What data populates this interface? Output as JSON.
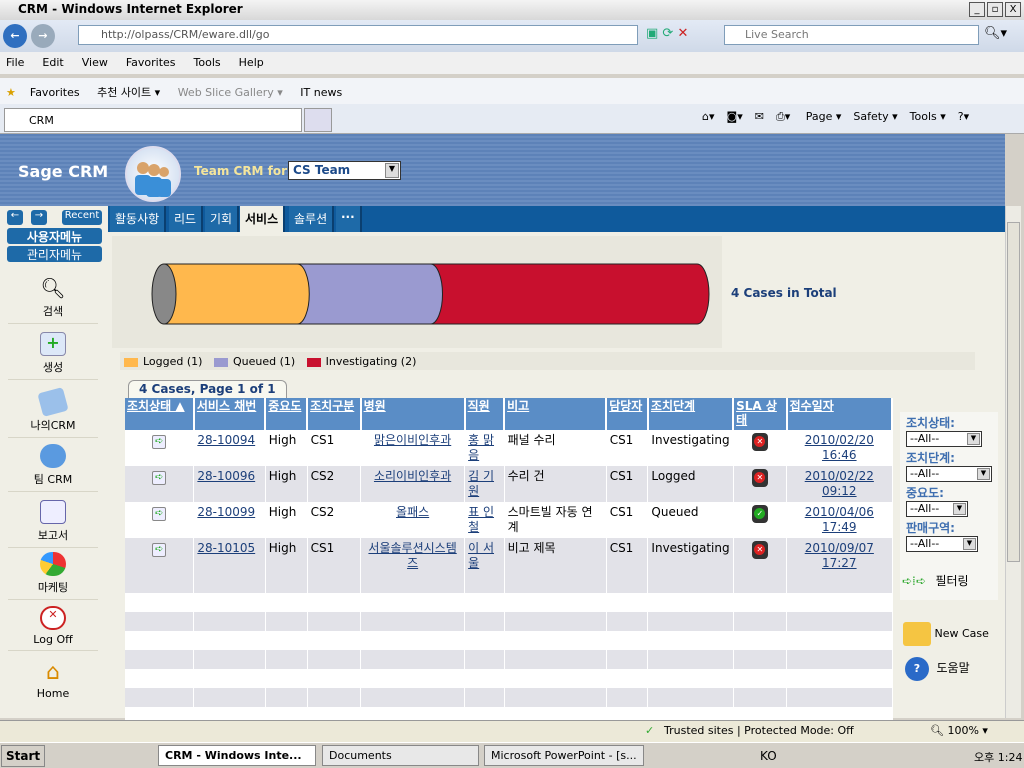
{
  "window": {
    "title": "CRM    - Windows Internet Explorer",
    "min": "_",
    "max": "▫",
    "close": "X"
  },
  "browser": {
    "url": "http://olpass/CRM/eware.dll/go",
    "search_placeholder": "Live Search",
    "menu": [
      "File",
      "Edit",
      "View",
      "Favorites",
      "Tools",
      "Help"
    ],
    "favorites": [
      "Favorites",
      "추천 사이트 ▾",
      "Web Slice Gallery ▾",
      "IT news"
    ],
    "tab": "CRM",
    "commands": [
      "Page ▾",
      "Safety ▾",
      "Tools ▾"
    ]
  },
  "crm": {
    "logo": "Sage CRM",
    "team_label": "Team CRM for:",
    "team_value": "CS Team",
    "recent": "Recent",
    "user_menu": "사용자메뉴",
    "admin_menu": "관리자메뉴",
    "tabs": [
      "활동사항",
      "리드",
      "기회",
      "서비스",
      "솔루션",
      "···"
    ],
    "active_tab": 3,
    "nav": [
      "검색",
      "생성",
      "나의CRM",
      "팀 CRM",
      "보고서",
      "마케팅",
      "Log Off",
      "Home"
    ]
  },
  "chart_data": {
    "type": "bar",
    "orientation": "stacked-horizontal-cylinder",
    "categories": [
      "Logged",
      "Queued",
      "Investigating"
    ],
    "values": [
      1,
      1,
      2
    ],
    "colors": [
      "#ffb84d",
      "#9a9ad0",
      "#c8102e"
    ],
    "legend": [
      "Logged (1)",
      "Queued (1)",
      "Investigating (2)"
    ],
    "legend_position": "bottom",
    "total_label": "4 Cases in Total"
  },
  "grid": {
    "caption": "4 Cases, Page 1 of 1",
    "columns": [
      "조치상태 ▲",
      "서비스 채번",
      "중요도",
      "조치구분",
      "병원",
      "직원",
      "비고",
      "담당자",
      "조치단계",
      "SLA 상태",
      "접수일자"
    ],
    "rows": [
      {
        "id": "28-10094",
        "priority": "High",
        "type": "CS1",
        "hospital": "맑은이비인후과",
        "staff": "홍 맑음",
        "note": "패널 수리",
        "owner": "CS1",
        "stage": "Investigating",
        "sla": "red",
        "date": "2010/02/20 16:46"
      },
      {
        "id": "28-10096",
        "priority": "High",
        "type": "CS2",
        "hospital": "소리이비인후과",
        "staff": "김 기원",
        "note": "수리 건",
        "owner": "CS1",
        "stage": "Logged",
        "sla": "red",
        "date": "2010/02/22 09:12"
      },
      {
        "id": "28-10099",
        "priority": "High",
        "type": "CS2",
        "hospital": "올패스",
        "staff": "표 인철",
        "note": "스마트빌 자동 연계",
        "owner": "CS1",
        "stage": "Queued",
        "sla": "green",
        "date": "2010/04/06 17:49"
      },
      {
        "id": "28-10105",
        "priority": "High",
        "type": "CS1",
        "hospital": "서울솔루션시스템즈",
        "staff": "이 서울",
        "note": "비고 제목",
        "owner": "CS1",
        "stage": "Investigating",
        "sla": "red",
        "date": "2010/09/07 17:27"
      }
    ]
  },
  "filters": {
    "items": [
      {
        "label": "조치상태:",
        "value": "--All--"
      },
      {
        "label": "조치단계:",
        "value": "--All--"
      },
      {
        "label": "중요도:",
        "value": "--All--"
      },
      {
        "label": "판매구역:",
        "value": "--All--"
      }
    ],
    "filter_button": "필터링",
    "new_case": "New Case",
    "help": "도움말"
  },
  "status": {
    "zone": "Trusted sites | Protected Mode: Off",
    "zoom": "100%"
  },
  "taskbar": {
    "start": "Start",
    "tasks": [
      "CRM    - Windows Inte...",
      "Documents",
      "Microsoft PowerPoint - [s..."
    ],
    "lang": "KO",
    "clock": "오후 1:24"
  }
}
